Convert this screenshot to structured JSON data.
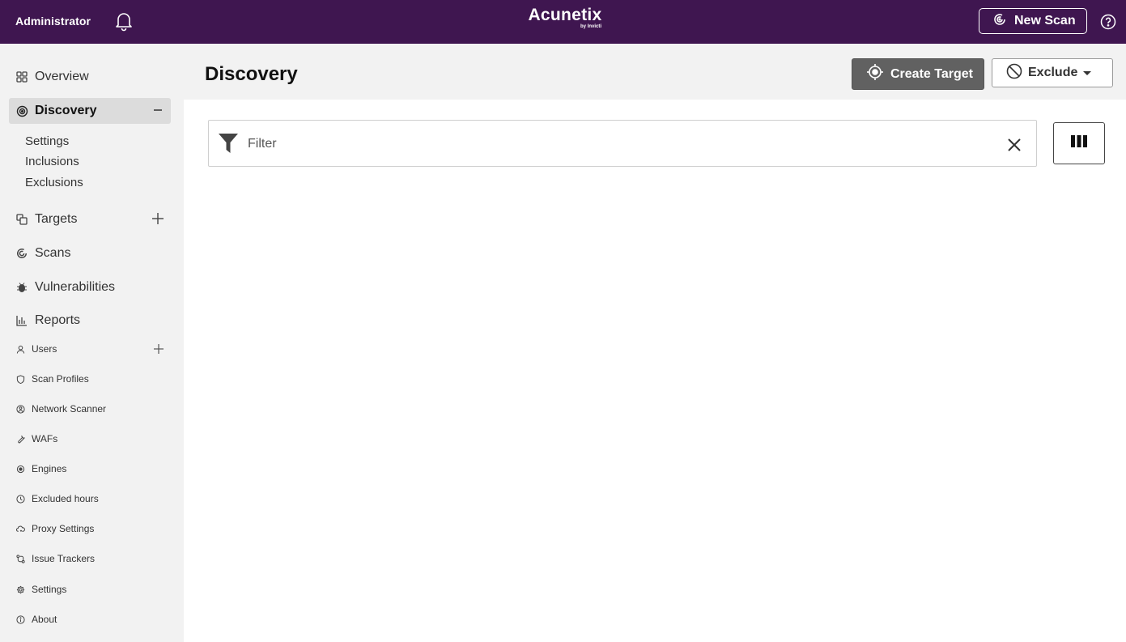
{
  "topbar": {
    "user": "Administrator",
    "brand": "Acunetix",
    "brand_sub": "by Invicti",
    "new_scan_label": "New Scan"
  },
  "sidebar": {
    "overview": "Overview",
    "discovery": "Discovery",
    "discovery_sub": [
      "Settings",
      "Inclusions",
      "Exclusions"
    ],
    "targets": "Targets",
    "scans": "Scans",
    "vulnerabilities": "Vulnerabilities",
    "reports": "Reports",
    "users": "Users",
    "scan_profiles": "Scan Profiles",
    "network_scanner": "Network Scanner",
    "wafs": "WAFs",
    "engines": "Engines",
    "excluded_hours": "Excluded hours",
    "proxy_settings": "Proxy Settings",
    "issue_trackers": "Issue Trackers",
    "settings": "Settings",
    "about": "About"
  },
  "page": {
    "title": "Discovery",
    "create_target_label": "Create Target",
    "exclude_label": "Exclude"
  },
  "filter": {
    "placeholder": "Filter"
  },
  "colors": {
    "topbar": "#3f1650",
    "sidebar": "#f2f2f2",
    "create_button": "#616161"
  }
}
